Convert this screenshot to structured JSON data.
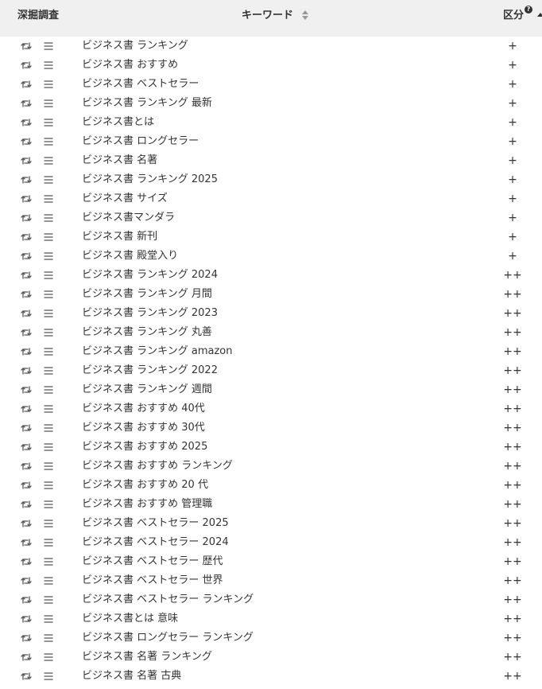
{
  "header": {
    "deep_research": "深掘調査",
    "keyword": "キーワード",
    "category": "区分",
    "help_mark": "?"
  },
  "icons": {
    "retweet": "retweet-icon",
    "menu": "menu-icon",
    "sort": "sort-icon",
    "help": "help-icon",
    "caret": "caret-up-icon"
  },
  "rows": [
    {
      "keyword": "ビジネス書 ランキング",
      "category": "+"
    },
    {
      "keyword": "ビジネス書 おすすめ",
      "category": "+"
    },
    {
      "keyword": "ビジネス書 ベストセラー",
      "category": "+"
    },
    {
      "keyword": "ビジネス書 ランキング 最新",
      "category": "+"
    },
    {
      "keyword": "ビジネス書とは",
      "category": "+"
    },
    {
      "keyword": "ビジネス書 ロングセラー",
      "category": "+"
    },
    {
      "keyword": "ビジネス書 名著",
      "category": "+"
    },
    {
      "keyword": "ビジネス書 ランキング 2025",
      "category": "+"
    },
    {
      "keyword": "ビジネス書 サイズ",
      "category": "+"
    },
    {
      "keyword": "ビジネス書マンダラ",
      "category": "+"
    },
    {
      "keyword": "ビジネス書 新刊",
      "category": "+"
    },
    {
      "keyword": "ビジネス書 殿堂入り",
      "category": "+"
    },
    {
      "keyword": "ビジネス書 ランキング 2024",
      "category": "++"
    },
    {
      "keyword": "ビジネス書 ランキング 月間",
      "category": "++"
    },
    {
      "keyword": "ビジネス書 ランキング 2023",
      "category": "++"
    },
    {
      "keyword": "ビジネス書 ランキング 丸善",
      "category": "++"
    },
    {
      "keyword": "ビジネス書 ランキング amazon",
      "category": "++"
    },
    {
      "keyword": "ビジネス書 ランキング 2022",
      "category": "++"
    },
    {
      "keyword": "ビジネス書 ランキング 週間",
      "category": "++"
    },
    {
      "keyword": "ビジネス書 おすすめ 40代",
      "category": "++"
    },
    {
      "keyword": "ビジネス書 おすすめ 30代",
      "category": "++"
    },
    {
      "keyword": "ビジネス書 おすすめ 2025",
      "category": "++"
    },
    {
      "keyword": "ビジネス書 おすすめ ランキング",
      "category": "++"
    },
    {
      "keyword": "ビジネス書 おすすめ 20 代",
      "category": "++"
    },
    {
      "keyword": "ビジネス書 おすすめ 管理職",
      "category": "++"
    },
    {
      "keyword": "ビジネス書 ベストセラー 2025",
      "category": "++"
    },
    {
      "keyword": "ビジネス書 ベストセラー 2024",
      "category": "++"
    },
    {
      "keyword": "ビジネス書 ベストセラー 歴代",
      "category": "++"
    },
    {
      "keyword": "ビジネス書 ベストセラー 世界",
      "category": "++"
    },
    {
      "keyword": "ビジネス書 ベストセラー ランキング",
      "category": "++"
    },
    {
      "keyword": "ビジネス書とは 意味",
      "category": "++"
    },
    {
      "keyword": "ビジネス書 ロングセラー ランキング",
      "category": "++"
    },
    {
      "keyword": "ビジネス書 名著 ランキング",
      "category": "++"
    },
    {
      "keyword": "ビジネス書 名著 古典",
      "category": "++"
    }
  ]
}
